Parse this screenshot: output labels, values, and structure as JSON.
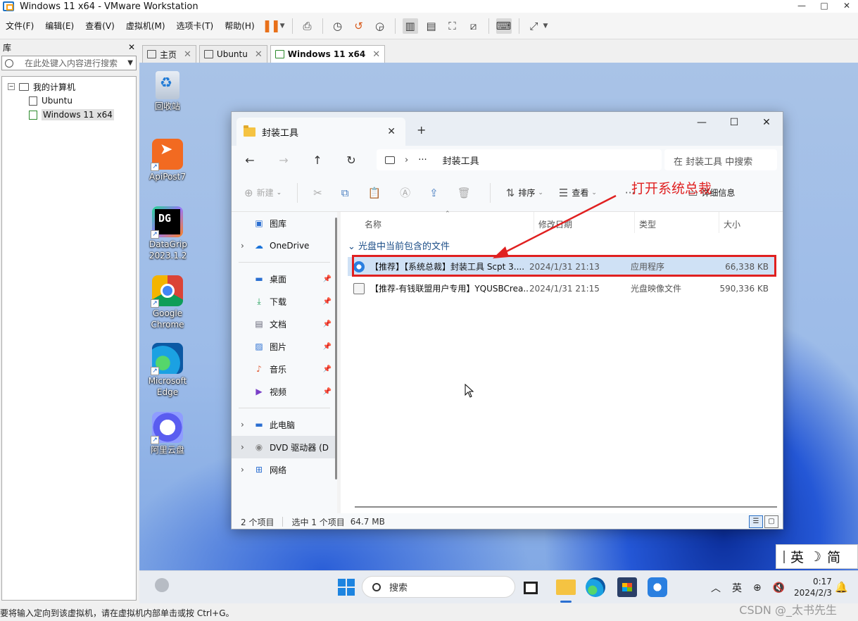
{
  "window": {
    "title": "Windows 11 x64 - VMware Workstation",
    "controls": [
      "—",
      "□",
      "✕"
    ]
  },
  "menu": [
    "文件(F)",
    "编辑(E)",
    "查看(V)",
    "虚拟机(M)",
    "选项卡(T)",
    "帮助(H)"
  ],
  "library": {
    "title": "库",
    "close": "✕",
    "search_placeholder": "在此处键入内容进行搜索",
    "tree": {
      "root_label": "我的计算机",
      "items": [
        "Ubuntu",
        "Windows 11 x64"
      ],
      "selected": "Windows 11 x64"
    }
  },
  "vm_tabs": [
    {
      "label": "主页",
      "active": false
    },
    {
      "label": "Ubuntu",
      "active": false
    },
    {
      "label": "Windows 11 x64",
      "active": true
    }
  ],
  "desktop_icons": [
    {
      "label": "回收站",
      "icon": "recycle-bin-icon"
    },
    {
      "label": "ApiPost7",
      "icon": "apipost-icon"
    },
    {
      "label": "DataGrip 2023.1.2",
      "icon": "datagrip-icon"
    },
    {
      "label": "Google Chrome",
      "icon": "chrome-icon"
    },
    {
      "label": "Microsoft Edge",
      "icon": "edge-icon"
    },
    {
      "label": "阿里云盘",
      "icon": "aliyun-drive-icon"
    }
  ],
  "explorer": {
    "tab_title": "封装工具",
    "breadcrumb": [
      "···",
      "封装工具"
    ],
    "search_placeholder": "在 封装工具 中搜索",
    "commands": {
      "new": "新建",
      "sort": "排序",
      "view": "查看",
      "details": "详细信息"
    },
    "nav": {
      "gallery": "图库",
      "onedrive": "OneDrive",
      "quick": [
        "桌面",
        "下载",
        "文档",
        "图片",
        "音乐",
        "视频"
      ],
      "this_pc": "此电脑",
      "dvd": "DVD 驱动器 (D",
      "network": "网络"
    },
    "columns": [
      "名称",
      "修改日期",
      "类型",
      "大小"
    ],
    "group_label": "光盘中当前包含的文件",
    "files": [
      {
        "name": "【推荐】【系统总裁】封装工具 Scpt 3....",
        "date": "2024/1/31 21:13",
        "type": "应用程序",
        "size": "66,338 KB",
        "selected": true
      },
      {
        "name": "【推荐-有钱联盟用户专用】YQUSBCrea...",
        "date": "2024/1/31 21:15",
        "type": "光盘映像文件",
        "size": "590,336 KB",
        "selected": false
      }
    ],
    "status": {
      "count": "2 个项目",
      "selection": "选中 1 个项目",
      "size": "64.7 MB"
    }
  },
  "annotation": {
    "text": "打开系统总裁",
    "color": "#e02020"
  },
  "ime": {
    "lang": "英",
    "mode": "☽",
    "script": "简"
  },
  "taskbar": {
    "search_placeholder": "搜索",
    "tray_lang": "英",
    "time": "0:17",
    "date": "2024/2/3"
  },
  "statusbar": {
    "hint": "要将输入定向到该虚拟机，请在虚拟机内部单击或按 Ctrl+G。"
  },
  "watermark": "CSDN @_太书先生"
}
